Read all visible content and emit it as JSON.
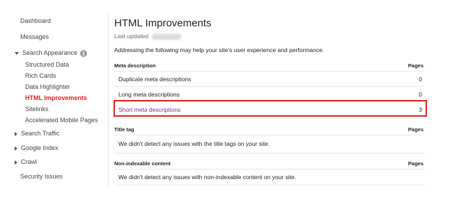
{
  "sidebar": {
    "dashboard": "Dashboard",
    "messages": "Messages",
    "search_appearance": "Search Appearance",
    "search_appearance_items": [
      "Structured Data",
      "Rich Cards",
      "Data Highlighter",
      "HTML Improvements",
      "Sitelinks",
      "Accelerated Mobile Pages"
    ],
    "active_item": "HTML Improvements",
    "search_traffic": "Search Traffic",
    "google_index": "Google Index",
    "crawl": "Crawl",
    "security_issues": "Security Issues",
    "info_icon_glyph": "i"
  },
  "main": {
    "title": "HTML Improvements",
    "last_updated_label": "Last updated",
    "intro": "Addressing the following may help your site's user experience and performance.",
    "meta_section": {
      "header": "Meta description",
      "pages_header": "Pages",
      "rows": [
        {
          "label": "Duplicate meta descriptions",
          "count": "0"
        },
        {
          "label": "Long meta descriptions",
          "count": "0"
        },
        {
          "label": "Short meta descriptions",
          "count": "3"
        }
      ]
    },
    "title_section": {
      "header": "Title tag",
      "pages_header": "Pages",
      "note": "We didn't detect any issues with the title tags on your site."
    },
    "nonindexable_section": {
      "header": "Non-indexable content",
      "pages_header": "Pages",
      "note": "We didn't detect any issues with non-indexable content on your site."
    }
  },
  "colors": {
    "active_nav": "#dd2222",
    "highlight_border": "#e02020",
    "link_purple": "#8a2b8f"
  }
}
